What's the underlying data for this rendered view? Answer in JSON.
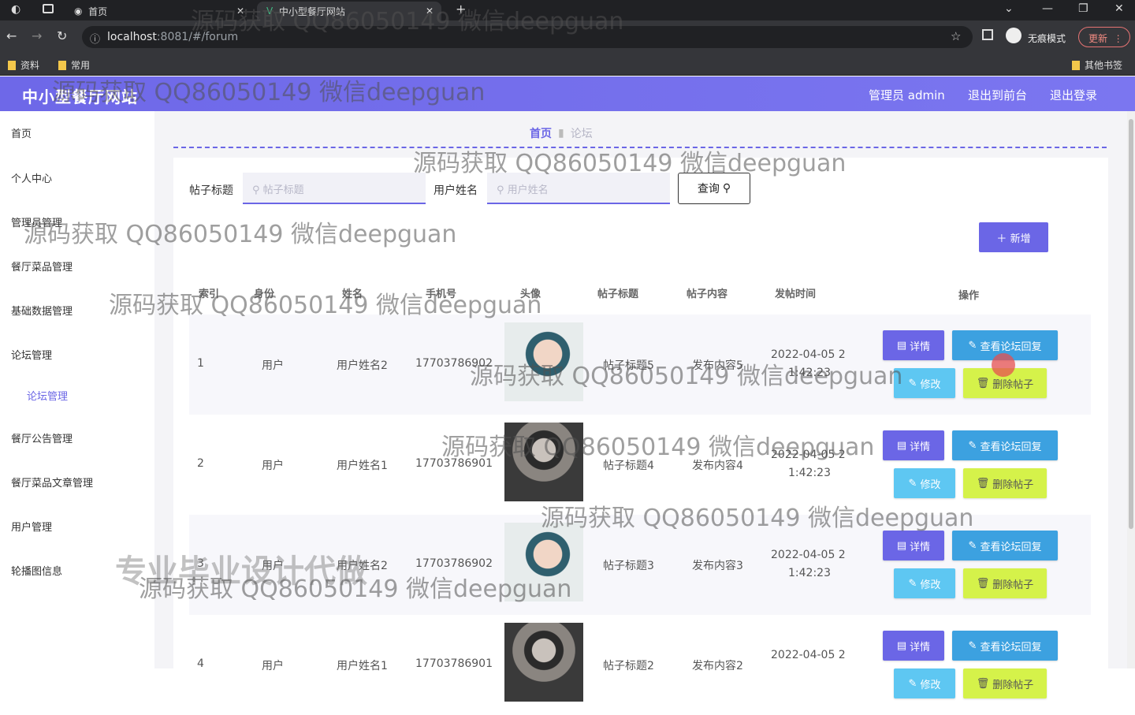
{
  "browser": {
    "tabs": [
      {
        "label": "首页"
      },
      {
        "label": "中小型餐厅网站"
      }
    ],
    "url_host": "localhost",
    "url_rest": ":8081/#/forum",
    "incognito_label": "无痕模式",
    "update_label": "更新",
    "bookmarks": [
      "资料",
      "常用"
    ],
    "other_bookmarks": "其他书签"
  },
  "header": {
    "title": "中小型餐厅网站",
    "admin_label": "管理员 admin",
    "front_label": "退出到前台",
    "logout_label": "退出登录"
  },
  "sidebar": {
    "items": [
      "首页",
      "个人中心",
      "管理员管理",
      "餐厅菜品管理",
      "基础数据管理",
      "论坛管理",
      "论坛管理",
      "餐厅公告管理",
      "餐厅菜品文章管理",
      "用户管理",
      "轮播图信息"
    ]
  },
  "breadcrumb": {
    "home": "首页",
    "current": "论坛"
  },
  "search": {
    "title_label": "帖子标题",
    "title_placeholder": "帖子标题",
    "user_label": "用户姓名",
    "user_placeholder": "用户姓名",
    "query_label": "查询"
  },
  "add_label": "新增",
  "table": {
    "headers": [
      "索引",
      "身份",
      "姓名",
      "手机号",
      "头像",
      "帖子标题",
      "帖子内容",
      "发帖时间",
      "操作"
    ],
    "rows": [
      {
        "index": "1",
        "role": "用户",
        "name": "用户姓名2",
        "phone": "17703786902",
        "avatar": "girl",
        "title": "帖子标题5",
        "content": "发布内容5",
        "time1": "2022-04-05 2",
        "time2": "1:42:23"
      },
      {
        "index": "2",
        "role": "用户",
        "name": "用户姓名1",
        "phone": "17703786901",
        "avatar": "boy",
        "title": "帖子标题4",
        "content": "发布内容4",
        "time1": "2022-04-05 2",
        "time2": "1:42:23"
      },
      {
        "index": "3",
        "role": "用户",
        "name": "用户姓名2",
        "phone": "17703786902",
        "avatar": "girl",
        "title": "帖子标题3",
        "content": "发布内容3",
        "time1": "2022-04-05 2",
        "time2": "1:42:23"
      },
      {
        "index": "4",
        "role": "用户",
        "name": "用户姓名1",
        "phone": "17703786901",
        "avatar": "boy",
        "title": "帖子标题2",
        "content": "发布内容2",
        "time1": "2022-04-05 2",
        "time2": ""
      }
    ],
    "actions": {
      "detail": "详情",
      "view_reply": "查看论坛回复",
      "edit": "修改",
      "delete": "删除帖子"
    }
  },
  "watermarks": {
    "qq": "源码获取 QQ86050149 微信deepguan",
    "promo": "专业毕业设计代做"
  }
}
